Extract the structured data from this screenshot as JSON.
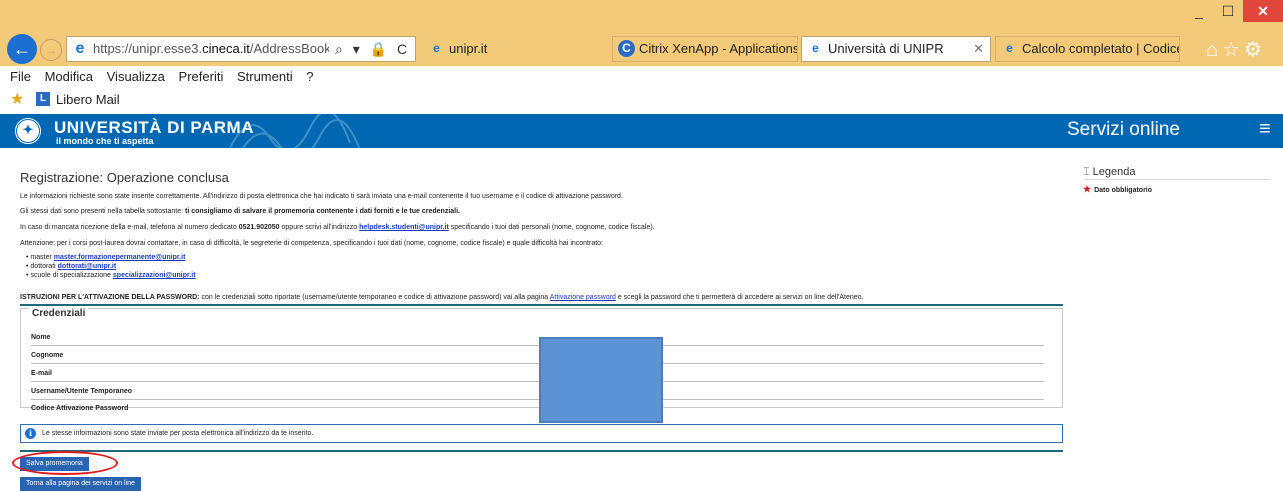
{
  "browser": {
    "window_controls": {
      "minimize": "_",
      "maximize": "☐",
      "close": "✕"
    },
    "address": {
      "url_prefix": "https://unipr.esse3.",
      "url_domain": "cineca.it",
      "url_rest": "/AddressBook/Riepi"
    },
    "address_tools": [
      "⌕",
      "▾",
      "🔒",
      "C"
    ],
    "tabs": [
      {
        "label": "unipr.it",
        "icon": "ie-icon"
      },
      {
        "label": "Citrix XenApp - Applications",
        "icon": "citrix-icon"
      },
      {
        "label": "Università di UNIPR",
        "icon": "ie-icon",
        "close": "✕"
      },
      {
        "label": "Calcolo completato | CodiceFi...",
        "icon": "ie-icon"
      }
    ],
    "toolbar_icons": "⌂☆⚙",
    "menu": [
      "File",
      "Modifica",
      "Visualizza",
      "Preferiti",
      "Strumenti",
      "?"
    ],
    "favorites": {
      "item": "Libero Mail"
    }
  },
  "site": {
    "brand": "UNIVERSITÀ DI PARMA",
    "tagline": "il mondo che ti aspetta",
    "services": "Servizi online",
    "menu_icon": "≡"
  },
  "page": {
    "title": "Registrazione: Operazione conclusa",
    "p1": "Le informazioni richieste sono state inserite correttamente. All'indirizzo di posta elettronica che hai indicato ti sarà inviata una e-mail contenente il tuo username e il codice di attivazione password.",
    "p2_text": "Gli stessi dati sono presenti nella tabella sottostante: ",
    "p2_bold": "ti consigliamo di salvare il promemoria contenente i dati forniti e le tue credenziali.",
    "p3_a": "In caso di mancata ricezione della e-mail, telefona al numero dedicato ",
    "p3_phone": "0521.902050",
    "p3_b": " oppure scrivi all'indirizzo ",
    "p3_email": "helpdesk.studenti@unipr.it",
    "p3_c": " specificando i tuoi dati personali (nome, cognome, codice fiscale).",
    "p4": "Attenzione: per i corsi post-laurea dovrai contattare, in caso di difficoltà, le segreterie di competenza, specificando i tuoi dati (nome, cognome, codice fiscale) e quale difficoltà hai incontrato:",
    "contacts": [
      {
        "label": "master ",
        "email": "master.formazionepermanente@unipr.it"
      },
      {
        "label": "dottorati ",
        "email": "dottorati@unipr.it"
      },
      {
        "label": "scuole di specializzazione ",
        "email": "specializzazioni@unipr.it"
      }
    ],
    "instr_bold": "ISTRUZIONI PER L'ATTIVAZIONE DELLA PASSWORD:",
    "instr_a": " con le credenziali sotto riportate (username/utente temporaneo e codice di attivazione password) vai alla pagina ",
    "instr_link": "Attivazione password",
    "instr_b": " e scegli la password che ti permetterà di accedere ai servizi on line dell'Ateneo.",
    "credentials": {
      "legend": "Credenziali",
      "rows": [
        "Nome",
        "Cognome",
        "E-mail",
        "Username/Utente Temporaneo",
        "Codice Attivazione Password"
      ]
    },
    "info_icon": "i",
    "info": "Le stesse informazioni sono state inviate per posta elettronica all'indirizzo da te inserito.",
    "save_button": "Salva promemoria",
    "back_button": "Torna alla pagina dei servizi on line"
  },
  "sidebar": {
    "legend_title": "Legenda",
    "required_label": "Dato obbligatorio"
  },
  "colors": {
    "brand_blue": "#0068b3",
    "title_bar": "#f3c97a",
    "button_blue": "#2a63b0",
    "annotation_red": "#e01a1a",
    "redaction": "#5b93d6"
  }
}
